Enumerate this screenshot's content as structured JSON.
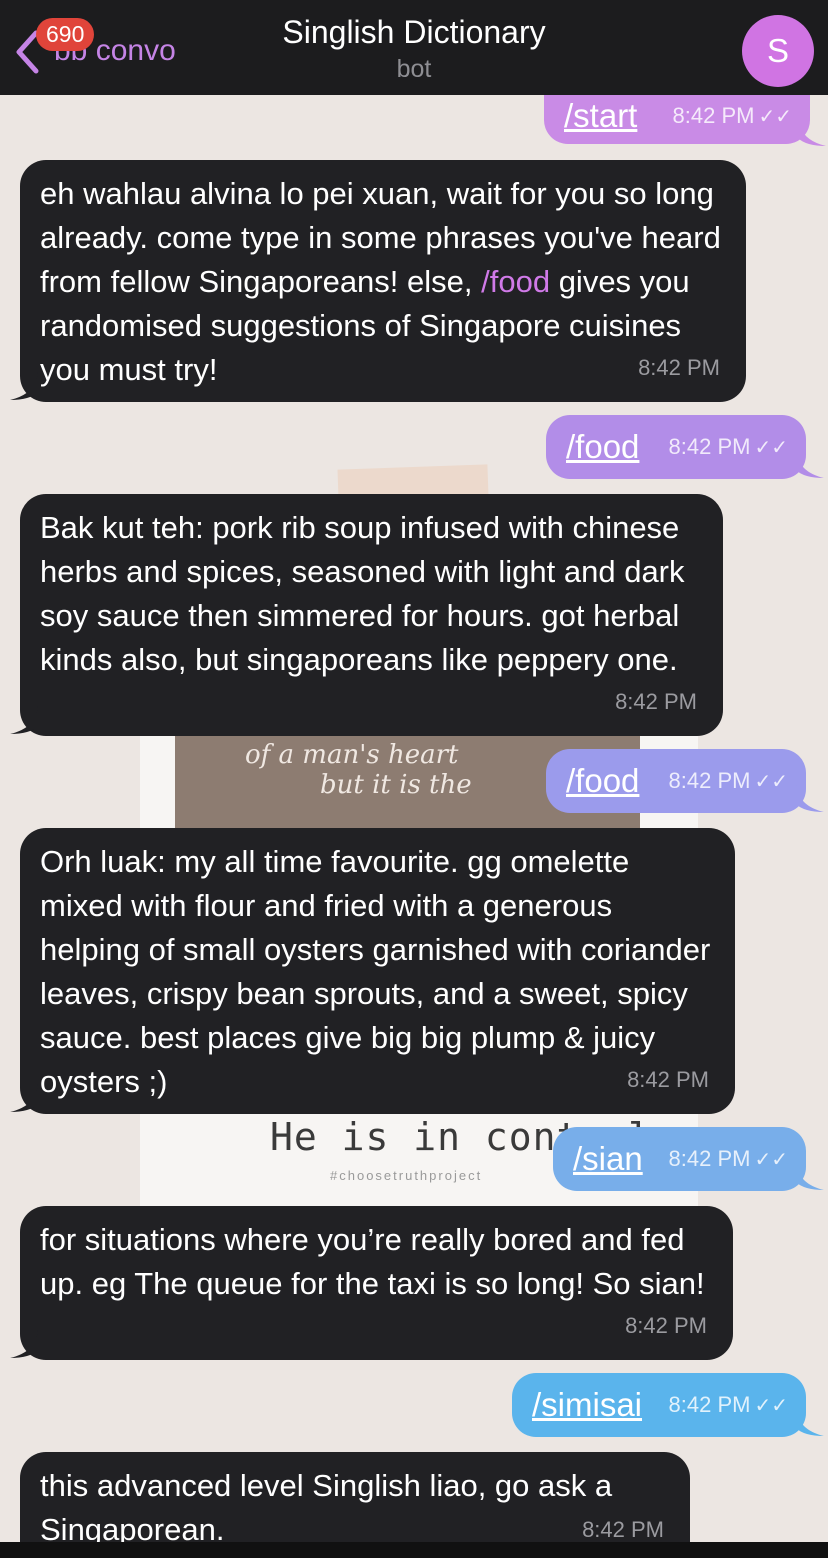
{
  "header": {
    "back_label": "bb convo",
    "unread_count": "690",
    "title": "Singlish Dictionary",
    "subtitle": "bot",
    "avatar_letter": "S"
  },
  "wallpaper": {
    "script_line1": "of a man's heart",
    "script_line2": "but it is the",
    "control_text": "He is in control",
    "hashtag": "#choosetruthproject"
  },
  "messages": [
    {
      "dir": "out",
      "text": "/start",
      "time": "8:42 PM",
      "color": "#c98be6"
    },
    {
      "dir": "in",
      "text_before": "eh wahlau alvina lo pei xuan, wait for you so long already. come type in some phrases you've heard from fellow Singaporeans! else, ",
      "link": "/food",
      "text_after": " gives you randomised suggestions of Singapore cuisines you must try!",
      "time": "8:42 PM"
    },
    {
      "dir": "out",
      "text": "/food",
      "time": "8:42 PM",
      "color": "#b28de8"
    },
    {
      "dir": "in",
      "text": "Bak kut teh: pork rib soup infused with chinese herbs and spices, seasoned with light and dark soy sauce then simmered for hours. got herbal kinds also, but singaporeans like peppery one.",
      "time": "8:42 PM"
    },
    {
      "dir": "out",
      "text": "/food",
      "time": "8:42 PM",
      "color": "#9b9bec"
    },
    {
      "dir": "in",
      "text": "Orh luak: my all time favourite. gg omelette mixed with flour and fried with a generous helping of small oysters garnished with coriander leaves, crispy bean sprouts, and a sweet, spicy sauce. best places give big big plump & juicy  oysters ;)",
      "time": "8:42 PM"
    },
    {
      "dir": "out",
      "text": "/sian",
      "time": "8:42 PM",
      "color": "#78aeea"
    },
    {
      "dir": "in",
      "text": "for situations where you’re really bored and fed up. eg  The queue for the taxi is so long! So sian!",
      "time": "8:42 PM"
    },
    {
      "dir": "out",
      "text": "/simisai",
      "time": "8:42 PM",
      "color": "#5ab4ec"
    },
    {
      "dir": "in",
      "text": "this advanced level Singlish liao, go ask a Singaporean.",
      "time": "8:42 PM"
    }
  ]
}
